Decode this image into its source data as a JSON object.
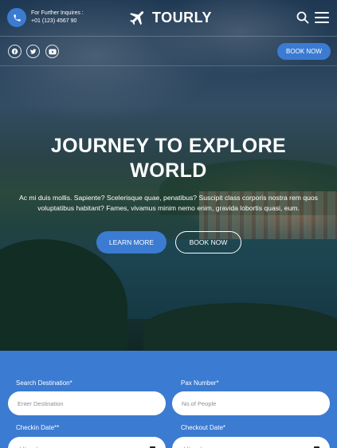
{
  "header": {
    "inquiry_title": "For Further Inquires :",
    "inquiry_phone": "+01 (123) 4567 90",
    "brand": "TOURLY",
    "book_now": "BOOK NOW"
  },
  "social": {
    "icons": [
      "facebook-icon",
      "twitter-icon",
      "youtube-icon"
    ]
  },
  "hero": {
    "title_line1": "JOURNEY TO EXPLORE",
    "title_line2": "WORLD",
    "description": "Ac mi duis mollis. Sapiente? Scelerisque quae, penatibus? Suscipit class corporis nostra rem quos voluptatibus habitant? Fames, vivamus minim nemo enim, gravida lobortis quasi, eum.",
    "learn_more": "LEARN MORE",
    "book_now": "BOOK NOW"
  },
  "form": {
    "destination_label": "Search Destination*",
    "destination_placeholder": "Enter Destination",
    "pax_label": "Pax Number*",
    "pax_placeholder": "No.of People",
    "checkin_label": "Checkin Date**",
    "checkin_placeholder": "dd/mm/yyyy",
    "checkout_label": "Checkout Date*",
    "checkout_placeholder": "dd/mm/yyyy"
  },
  "colors": {
    "accent": "#3b7bd2",
    "text": "#ffffff"
  }
}
